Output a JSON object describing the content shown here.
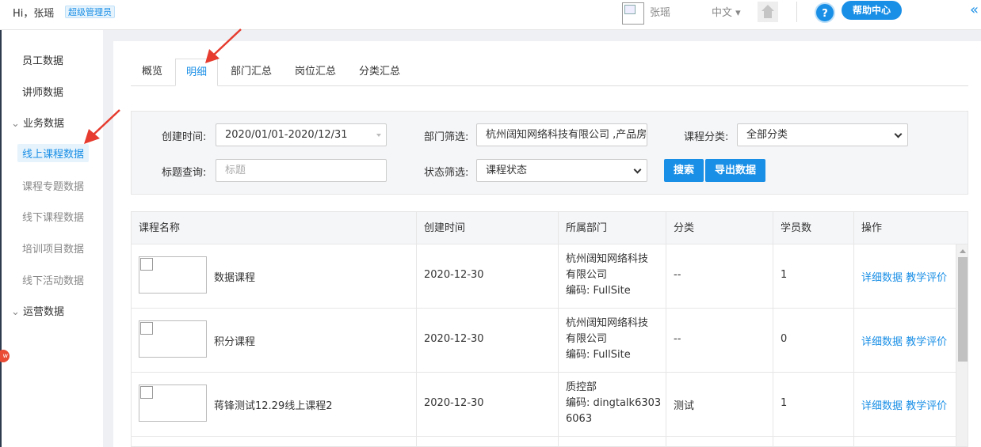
{
  "header": {
    "greeting": "Hi，张瑶",
    "role": "超级管理员",
    "user_name": "张瑶",
    "language": "中文 ▾",
    "help_icon_text": "?",
    "help_label": "帮助中心",
    "collapse_glyph": "«"
  },
  "sidebar": {
    "items": [
      {
        "label": "员工数据"
      },
      {
        "label": "讲师数据"
      },
      {
        "label": "业务数据",
        "group": true
      },
      {
        "label": "线上课程数据",
        "active": true
      },
      {
        "label": "课程专题数据"
      },
      {
        "label": "线下课程数据"
      },
      {
        "label": "培训项目数据"
      },
      {
        "label": "线下活动数据"
      },
      {
        "label": "运营数据",
        "group": true
      }
    ],
    "group_prefix": "⌄ ",
    "badge": "w"
  },
  "tabs": [
    {
      "label": "概览"
    },
    {
      "label": "明细",
      "active": true
    },
    {
      "label": "部门汇总"
    },
    {
      "label": "岗位汇总"
    },
    {
      "label": "分类汇总"
    }
  ],
  "filters": {
    "created_time": {
      "label": "创建时间:",
      "value": "2020/01/01-2020/12/31"
    },
    "department": {
      "label": "部门筛选:",
      "value": "杭州阔知网络科技有限公司 ,产品房"
    },
    "category": {
      "label": "课程分类:",
      "value": "全部分类"
    },
    "title": {
      "label": "标题查询:",
      "placeholder": "标题"
    },
    "status": {
      "label": "状态筛选:",
      "value": "课程状态"
    },
    "search_button": "搜索",
    "export_button": "导出数据"
  },
  "table": {
    "columns": [
      "课程名称",
      "创建时间",
      "所属部门",
      "分类",
      "学员数",
      "操作"
    ],
    "rows": [
      {
        "name": "数据课程",
        "created": "2020-12-30",
        "dept_lines": [
          "杭州阔知网络科技",
          "有限公司",
          "编码:  FullSite"
        ],
        "category": "--",
        "students": "1"
      },
      {
        "name": "积分课程",
        "created": "2020-12-30",
        "dept_lines": [
          "杭州阔知网络科技",
          "有限公司",
          "编码:  FullSite"
        ],
        "category": "--",
        "students": "0"
      },
      {
        "name": "蒋锋测试12.29线上课程2",
        "created": "2020-12-30",
        "dept_lines": [
          "质控部",
          "编码:  dingtalk6303",
          "6063"
        ],
        "category": "测试",
        "students": "1"
      }
    ],
    "op_detail": "详细数据",
    "op_review": "教学评价"
  },
  "colors": {
    "accent": "#1a8fe6",
    "annotation_arrow": "#e63b2e"
  }
}
